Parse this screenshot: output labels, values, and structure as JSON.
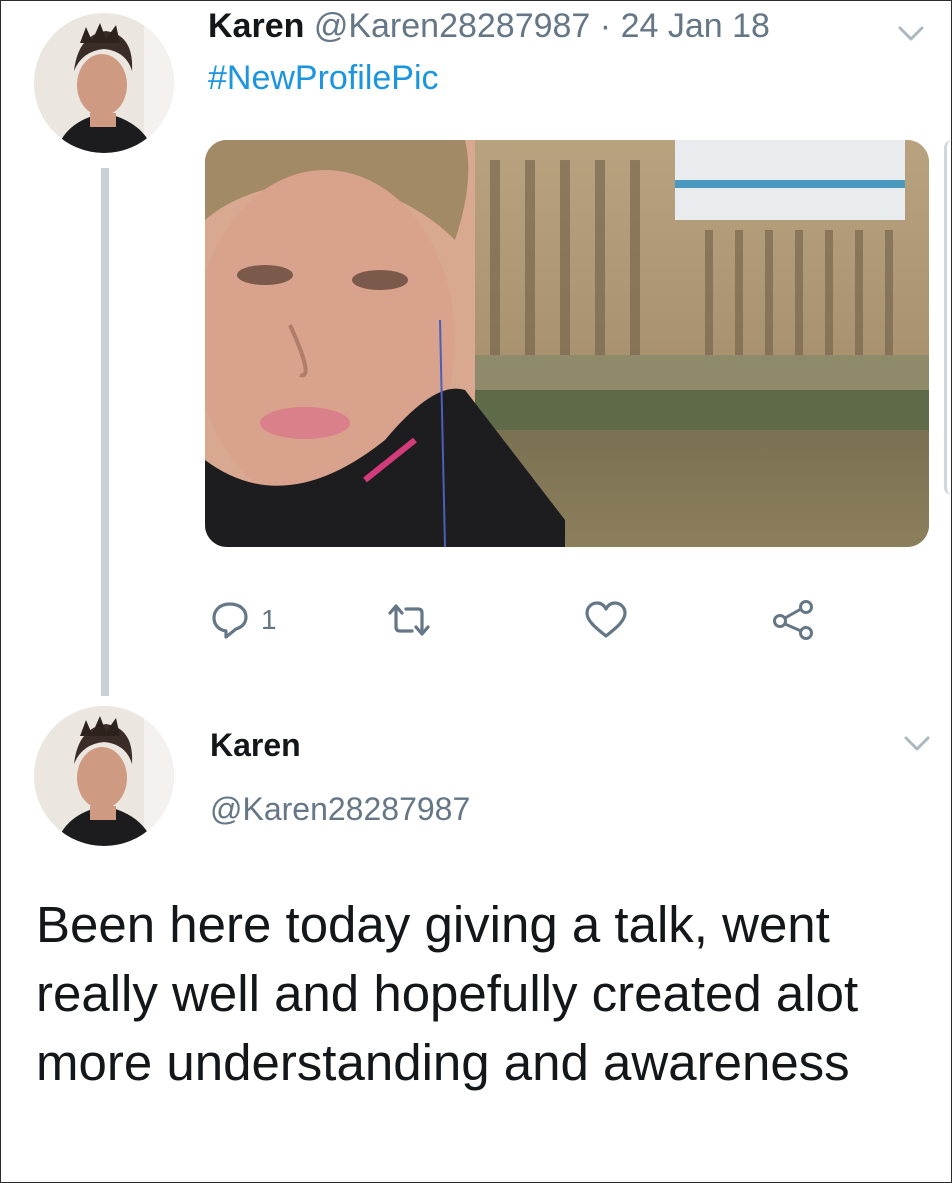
{
  "tweet1": {
    "name": "Karen",
    "handle": "@Karen28287987",
    "separator": "·",
    "date": "24 Jan 18",
    "text": "#NewProfilePic",
    "actions": {
      "reply_count": "1"
    }
  },
  "tweet2": {
    "name": "Karen",
    "handle": "@Karen28287987",
    "text": "Been here today giving a talk, went really well and hopefully created alot more understanding and awareness"
  },
  "icons": {
    "reply": "reply-icon",
    "retweet": "retweet-icon",
    "like": "heart-icon",
    "share": "share-icon",
    "menu": "chevron-down-icon"
  },
  "colors": {
    "link": "#1b95e0",
    "muted": "#657786",
    "thread_line": "#c9d1d8"
  }
}
